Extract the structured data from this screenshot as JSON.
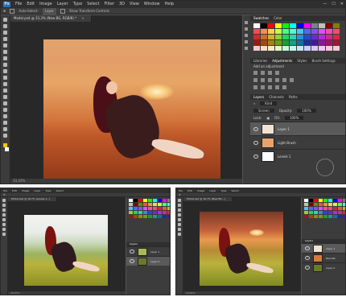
{
  "menu": {
    "logo": "Ps",
    "items": [
      "File",
      "Edit",
      "Image",
      "Layer",
      "Type",
      "Select",
      "Filter",
      "3D",
      "View",
      "Window",
      "Help"
    ],
    "window_buttons": [
      "—",
      "☐",
      "✕"
    ]
  },
  "options_bar": {
    "auto_select_label": "Auto-Select:",
    "auto_select_value": "Layer",
    "transform_label": "Show Transform Controls"
  },
  "main_document": {
    "tab_title": "Model.psd @ 33,3% (New BG, RGB/8) *",
    "status": "33,33%"
  },
  "right_panel": {
    "swatch_tabs": [
      "Swatches",
      "Color"
    ],
    "adjust_tabs": [
      "Libraries",
      "Adjustments",
      "Styles",
      "Brush Settings"
    ],
    "add_adjustment_label": "Add an adjustment",
    "layers_tabs": [
      "Layers",
      "Channels",
      "Paths"
    ],
    "kind_label": "Kind",
    "blend_mode": "Screen",
    "opacity_label": "Opacity:",
    "opacity_value": "100%",
    "fill_label": "Fill:",
    "fill_value": "100%",
    "lock_label": "Lock:",
    "layers": [
      {
        "name": "Layer 1",
        "thumb": "#f1e2d2",
        "selected": true
      },
      {
        "name": "Light Brush",
        "thumb": "#e7a36b",
        "selected": false
      },
      {
        "name": "Levels 1",
        "thumb": "#ffffff",
        "selected": false
      }
    ]
  },
  "swatch_colors": [
    "#ffffff",
    "#000000",
    "#ff0000",
    "#ffff00",
    "#00ff00",
    "#00ffff",
    "#0000ff",
    "#ff00ff",
    "#808080",
    "#c0c0c0",
    "#800000",
    "#808000",
    "#ff4b4b",
    "#ff8c4b",
    "#ffd34b",
    "#c4ff4b",
    "#4bff7a",
    "#4bffd9",
    "#4bc4ff",
    "#4b6bff",
    "#8c4bff",
    "#e44bff",
    "#ff4ba7",
    "#ff4b6a",
    "#d22a2a",
    "#d26a2a",
    "#d2b02a",
    "#93d22a",
    "#2ad257",
    "#2ad2b7",
    "#2a93d2",
    "#2a47d2",
    "#6a2ad2",
    "#b92ad2",
    "#d22a85",
    "#d22a47",
    "#9e1616",
    "#9e4b16",
    "#9e8516",
    "#6e9e16",
    "#169e3e",
    "#169e8a",
    "#166e9e",
    "#16319e",
    "#4b169e",
    "#8a169e",
    "#9e1662",
    "#9e1631",
    "#f7c8c8",
    "#f7dcc8",
    "#f7ecc8",
    "#e3f7c8",
    "#c8f7d3",
    "#c8f7ef",
    "#c8e3f7",
    "#c8d0f7",
    "#dcc8f7",
    "#f0c8f7",
    "#f7c8e0",
    "#f7c8cf"
  ],
  "small_left": {
    "tab_title": "Model.psd @ 16,7% (Levels 1...)",
    "status": "16,67%",
    "layers": [
      {
        "name": "Layer 1",
        "thumb": "#a9b85a"
      },
      {
        "name": "Layer 0",
        "thumb": "#6b7a2a"
      }
    ]
  },
  "small_right": {
    "tab_title": "Model.psd @ 16,7% (New BG...)",
    "status": "16,67%",
    "layers": [
      {
        "name": "Layer 1",
        "thumb": "#f1e2d2"
      },
      {
        "name": "New BG",
        "thumb": "#d97a3a"
      },
      {
        "name": "Layer 0",
        "thumb": "#6b7a2a"
      }
    ]
  }
}
